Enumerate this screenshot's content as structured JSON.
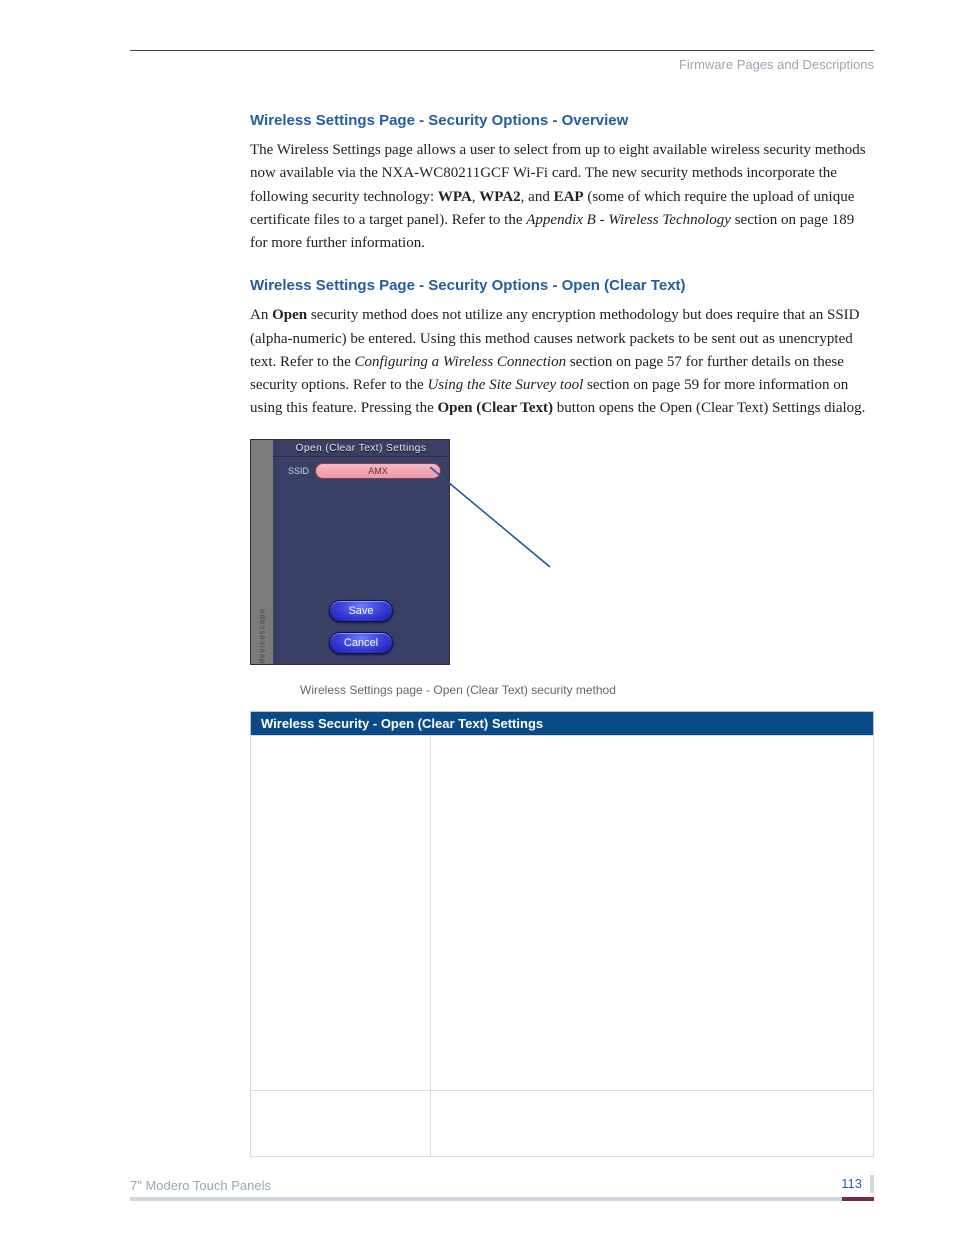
{
  "running_head": "Firmware Pages and Descriptions",
  "section1": {
    "title": "Wireless Settings Page - Security Options - Overview",
    "p1a": "The Wireless Settings page allows a user to select from up to eight available wireless security methods now available via the NXA-WC80211GCF Wi-Fi card. The new security methods incorporate the following security technology: ",
    "wpa": "WPA",
    "sep1": ", ",
    "wpa2": "WPA2",
    "sep2": ", and ",
    "eap": "EAP",
    "p1b": " (some of which require the upload of unique certificate files to a target panel). Refer to the ",
    "appendix": "Appendix B - Wireless Technology",
    "p1c": " section on page 189 for more further information."
  },
  "section2": {
    "title": "Wireless Settings Page - Security Options - Open (Clear Text)",
    "p_lead": "An ",
    "open": "Open",
    "p_a": " security method does not utilize any encryption methodology but does require that an SSID (alpha-numeric) be entered. Using this method causes network packets to be sent out as unencrypted text. Refer to the ",
    "ref1": "Configuring a Wireless Connection",
    "p_b": " section on page 57 for further details on these security options. Refer to the ",
    "ref2": "Using the Site Survey tool",
    "p_c": " section on page 59 for more information on using this feature. Pressing the ",
    "btn": "Open (Clear Text)",
    "p_d": " button opens the Open (Clear Text) Settings dialog."
  },
  "dialog": {
    "title": "Open (Clear Text) Settings",
    "side": "devicescape",
    "ssid_label": "SSID",
    "ssid_value": "AMX",
    "save": "Save",
    "cancel": "Cancel"
  },
  "fig_caption": "Wireless Settings page - Open (Clear Text) security method",
  "table_header": "Wireless Security - Open (Clear Text) Settings",
  "footer": {
    "left": "7\" Modero Touch Panels",
    "page": "113"
  }
}
